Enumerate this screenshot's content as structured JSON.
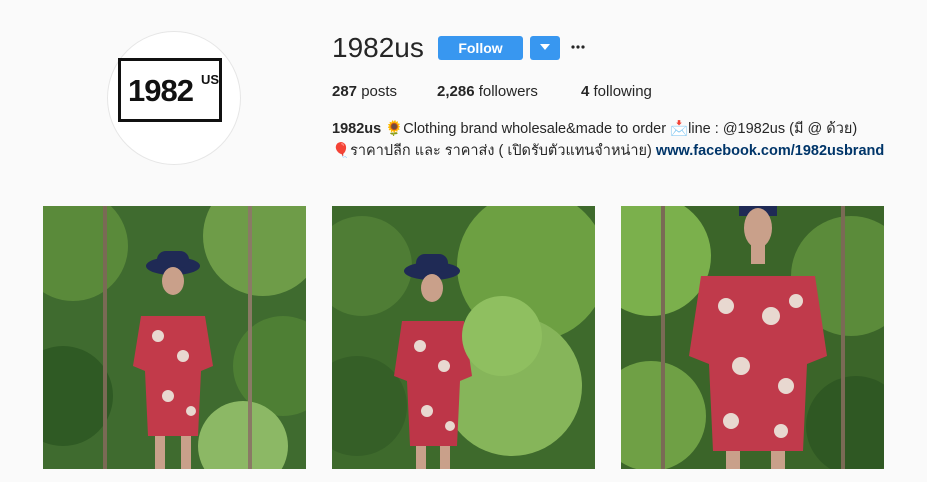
{
  "profile": {
    "username": "1982us",
    "logo_number": "1982",
    "logo_letters": "US"
  },
  "actions": {
    "follow_label": "Follow",
    "more_label": "•••"
  },
  "stats": {
    "posts_count": "287",
    "posts_label": "posts",
    "followers_count": "2,286",
    "followers_label": "followers",
    "following_count": "4",
    "following_label": "following"
  },
  "bio": {
    "name": "1982us",
    "sunflower_emoji": "🌻",
    "line1_text": "Clothing brand wholesale&made to order",
    "envelope_emoji": "📩",
    "line1_contact": "line : @1982us (มี @ ด้วย)",
    "balloon_emoji": "🎈",
    "line2_text": "ราคาปลีก และ ราคาส่ง ( เปิดรับตัวแทนจำหน่าย)",
    "link": "www.facebook.com/1982usbrand"
  },
  "colors": {
    "accent": "#3897f0",
    "link": "#003569",
    "background": "#fafafa"
  },
  "posts": [
    {
      "icon": "photo-woman-hat-floral-romper"
    },
    {
      "icon": "photo-woman-hat-floral-romper-side"
    },
    {
      "icon": "photo-floral-romper-closeup"
    }
  ]
}
